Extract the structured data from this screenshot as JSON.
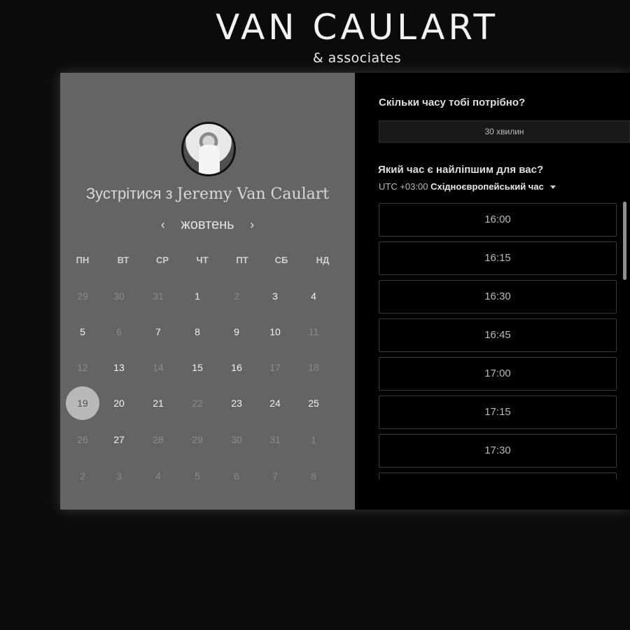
{
  "brand": {
    "title": "VAN CAULART",
    "subtitle": "& associates"
  },
  "calendar": {
    "meet_prefix": "Зустрітися з",
    "host_name": "Jeremy Van Caulart",
    "month": "жовтень",
    "prev_icon": "chevron-left-icon",
    "next_icon": "chevron-right-icon",
    "prev_glyph": "‹",
    "next_glyph": "›",
    "weekdays": [
      "ПН",
      "ВТ",
      "СР",
      "ЧТ",
      "ПТ",
      "СБ",
      "НД"
    ],
    "selected_day": "19",
    "weeks": [
      [
        {
          "d": "29",
          "s": "disabled"
        },
        {
          "d": "30",
          "s": "disabled"
        },
        {
          "d": "31",
          "s": "disabled"
        },
        {
          "d": "1",
          "s": "enabled"
        },
        {
          "d": "2",
          "s": "disabled"
        },
        {
          "d": "3",
          "s": "enabled"
        },
        {
          "d": "4",
          "s": "enabled"
        }
      ],
      [
        {
          "d": "5",
          "s": "enabled"
        },
        {
          "d": "6",
          "s": "disabled"
        },
        {
          "d": "7",
          "s": "enabled"
        },
        {
          "d": "8",
          "s": "enabled"
        },
        {
          "d": "9",
          "s": "enabled"
        },
        {
          "d": "10",
          "s": "enabled"
        },
        {
          "d": "11",
          "s": "disabled"
        }
      ],
      [
        {
          "d": "12",
          "s": "disabled"
        },
        {
          "d": "13",
          "s": "enabled"
        },
        {
          "d": "14",
          "s": "disabled"
        },
        {
          "d": "15",
          "s": "enabled"
        },
        {
          "d": "16",
          "s": "enabled"
        },
        {
          "d": "17",
          "s": "disabled"
        },
        {
          "d": "18",
          "s": "disabled"
        }
      ],
      [
        {
          "d": "19",
          "s": "selected"
        },
        {
          "d": "20",
          "s": "enabled"
        },
        {
          "d": "21",
          "s": "enabled"
        },
        {
          "d": "22",
          "s": "disabled"
        },
        {
          "d": "23",
          "s": "enabled"
        },
        {
          "d": "24",
          "s": "enabled"
        },
        {
          "d": "25",
          "s": "enabled"
        }
      ],
      [
        {
          "d": "26",
          "s": "disabled"
        },
        {
          "d": "27",
          "s": "enabled"
        },
        {
          "d": "28",
          "s": "disabled"
        },
        {
          "d": "29",
          "s": "disabled"
        },
        {
          "d": "30",
          "s": "disabled"
        },
        {
          "d": "31",
          "s": "disabled"
        },
        {
          "d": "1",
          "s": "disabled"
        }
      ],
      [
        {
          "d": "2",
          "s": "disabled"
        },
        {
          "d": "3",
          "s": "disabled"
        },
        {
          "d": "4",
          "s": "disabled"
        },
        {
          "d": "5",
          "s": "disabled"
        },
        {
          "d": "6",
          "s": "disabled"
        },
        {
          "d": "7",
          "s": "disabled"
        },
        {
          "d": "8",
          "s": "disabled"
        }
      ]
    ]
  },
  "booking": {
    "duration_question": "Скільки часу тобі потрібно?",
    "duration_value": "30 хвилин",
    "time_question": "Який час є найліпшим для вас?",
    "tz_offset": "UTC +03:00",
    "tz_name": "Східноєвропейський час",
    "slots": [
      "16:00",
      "16:15",
      "16:30",
      "16:45",
      "17:00",
      "17:15",
      "17:30",
      ""
    ]
  },
  "colors": {
    "page_bg": "#0b0b0b",
    "calendar_bg": "#646464",
    "slots_bg": "#000000",
    "selected_day_bg": "#b8b8b8"
  }
}
